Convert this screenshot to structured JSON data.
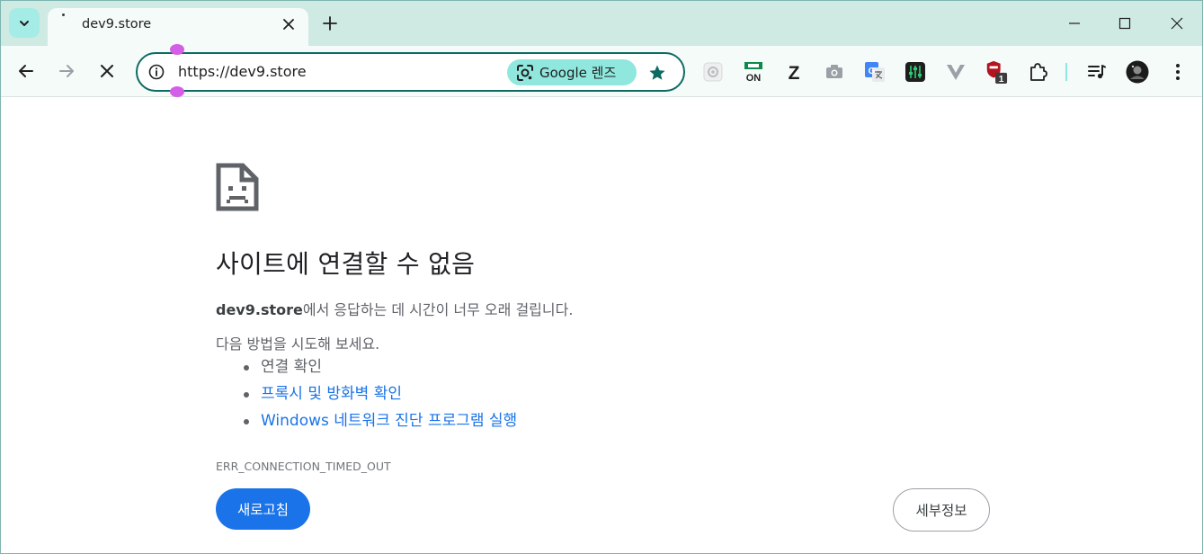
{
  "tab": {
    "title": "dev9.store"
  },
  "omnibox": {
    "url": "https://dev9.store",
    "lens_label": "Google 렌즈"
  },
  "extensions": {
    "on_label": "ON",
    "z_label": "Z",
    "badge_count": "1"
  },
  "error": {
    "heading": "사이트에 연결할 수 없음",
    "domain": "dev9.store",
    "detail_suffix": "에서 응답하는 데 시간이 너무 오래 걸립니다.",
    "try_label": "다음 방법을 시도해 보세요.",
    "suggestions": [
      "연결 확인",
      "프록시 및 방화벽 확인",
      "Windows 네트워크 진단 프로그램 실행"
    ],
    "code": "ERR_CONNECTION_TIMED_OUT",
    "reload_label": "새로고침",
    "details_label": "세부정보"
  },
  "colors": {
    "frame": "#cfe9e3",
    "toolbar": "#f5fbf9",
    "accent": "#0d6b62",
    "lens": "#8fe7de",
    "primary_button": "#1a73e8",
    "link": "#1a73e8"
  }
}
